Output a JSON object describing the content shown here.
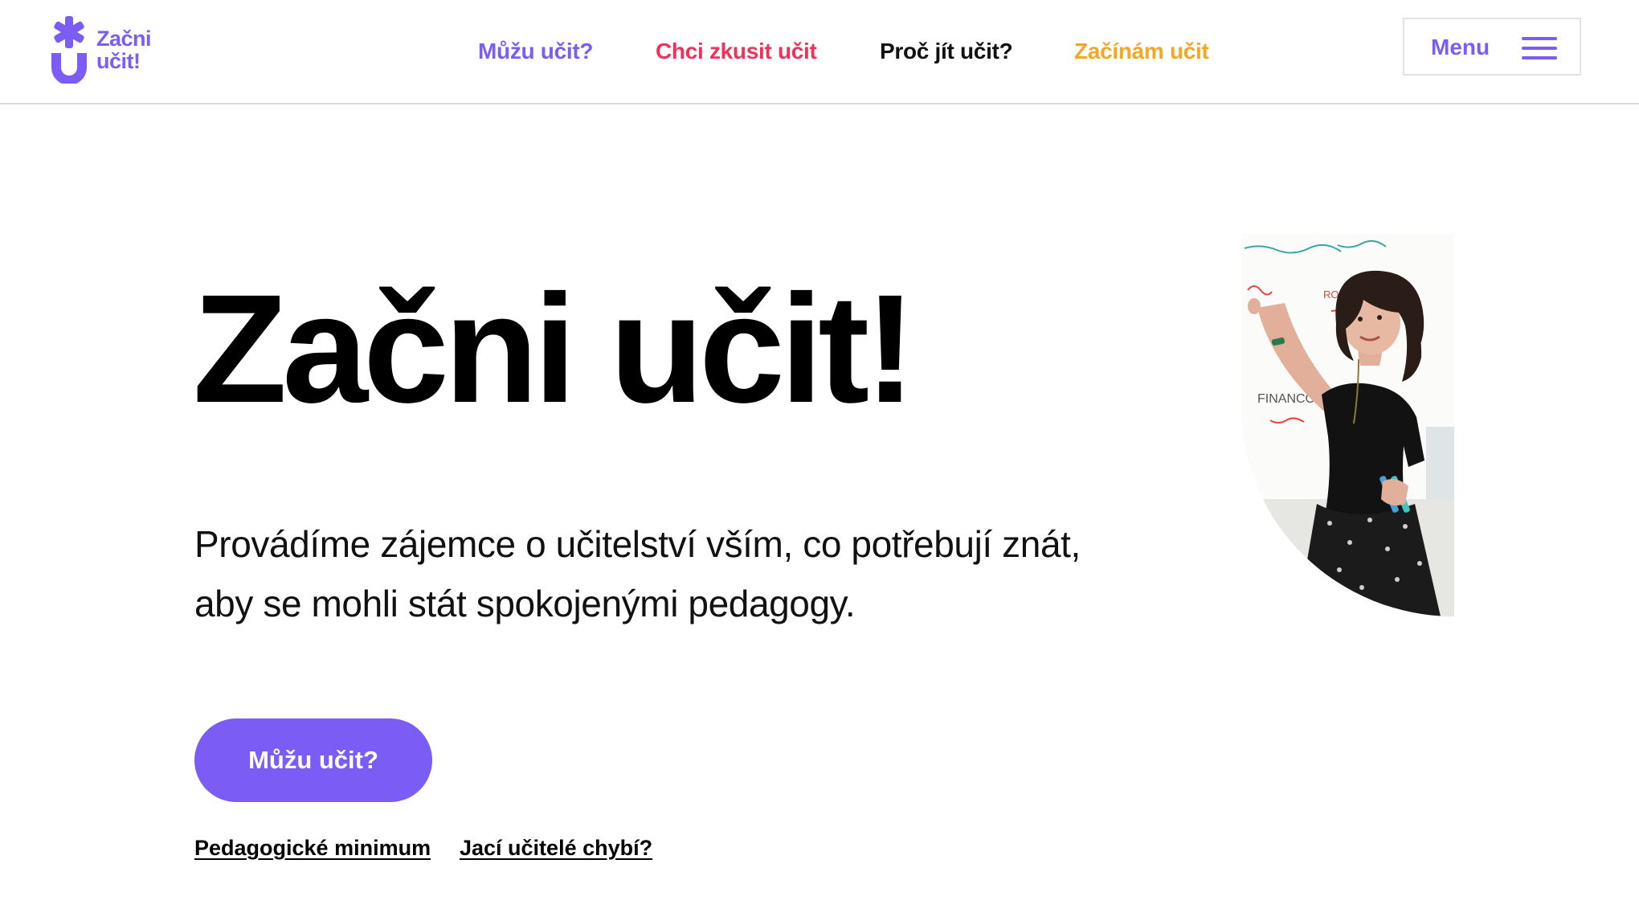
{
  "header": {
    "logo": {
      "line1": "Začni",
      "line2": "učit!",
      "icon": "asterisk-u-logo-icon",
      "color": "#7B5CF5"
    },
    "nav": [
      {
        "label": "Můžu učit?",
        "color": "#7B5CF5"
      },
      {
        "label": "Chci zkusit učit",
        "color": "#F0325A"
      },
      {
        "label": "Proč jít učit?",
        "color": "#111111"
      },
      {
        "label": "Začínám učit",
        "color": "#F5A623"
      }
    ],
    "menu": {
      "label": "Menu",
      "icon": "hamburger-icon"
    }
  },
  "hero": {
    "title": "Začni učit!",
    "description": "Provádíme zájemce o učitelství vším, co potřebují znát, aby se mohli stát spokojenými pedagogy.",
    "cta": "Můžu učit?",
    "links": [
      "Pedagogické minimum",
      "Jací učitelé chybí?"
    ],
    "image_icon": "teacher-whiteboard-photo",
    "whiteboard_texts": [
      "ROZHODNUTÍ",
      "FINANCOVÁNÍ"
    ]
  },
  "colors": {
    "accent": "#7B5CF5",
    "pink": "#F0325A",
    "orange": "#F5A623"
  }
}
